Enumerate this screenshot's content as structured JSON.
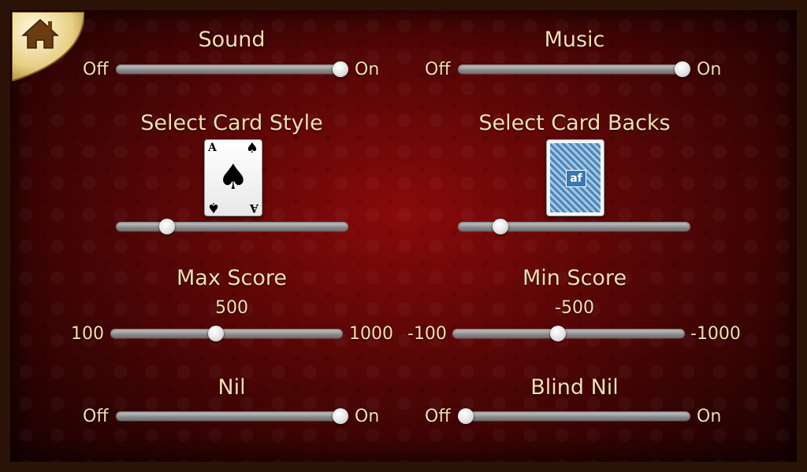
{
  "home": {
    "icon": "home-icon"
  },
  "sound": {
    "title": "Sound",
    "min_label": "Off",
    "max_label": "On",
    "value": 1
  },
  "music": {
    "title": "Music",
    "min_label": "Off",
    "max_label": "On",
    "value": 1
  },
  "card_style": {
    "title": "Select Card Style",
    "rank": "A",
    "suit": "♠",
    "value": 0.2
  },
  "card_backs": {
    "title": "Select Card Backs",
    "logo": "af",
    "value": 0.16
  },
  "max_score": {
    "title": "Max Score",
    "current": "500",
    "min_label": "100",
    "max_label": "1000",
    "value": 0.45
  },
  "min_score": {
    "title": "Min Score",
    "current": "-500",
    "min_label": "-100",
    "max_label": "-1000",
    "value": 0.45
  },
  "nil": {
    "title": "Nil",
    "min_label": "Off",
    "max_label": "On",
    "value": 1
  },
  "blind_nil": {
    "title": "Blind Nil",
    "min_label": "Off",
    "max_label": "On",
    "value": 0
  }
}
